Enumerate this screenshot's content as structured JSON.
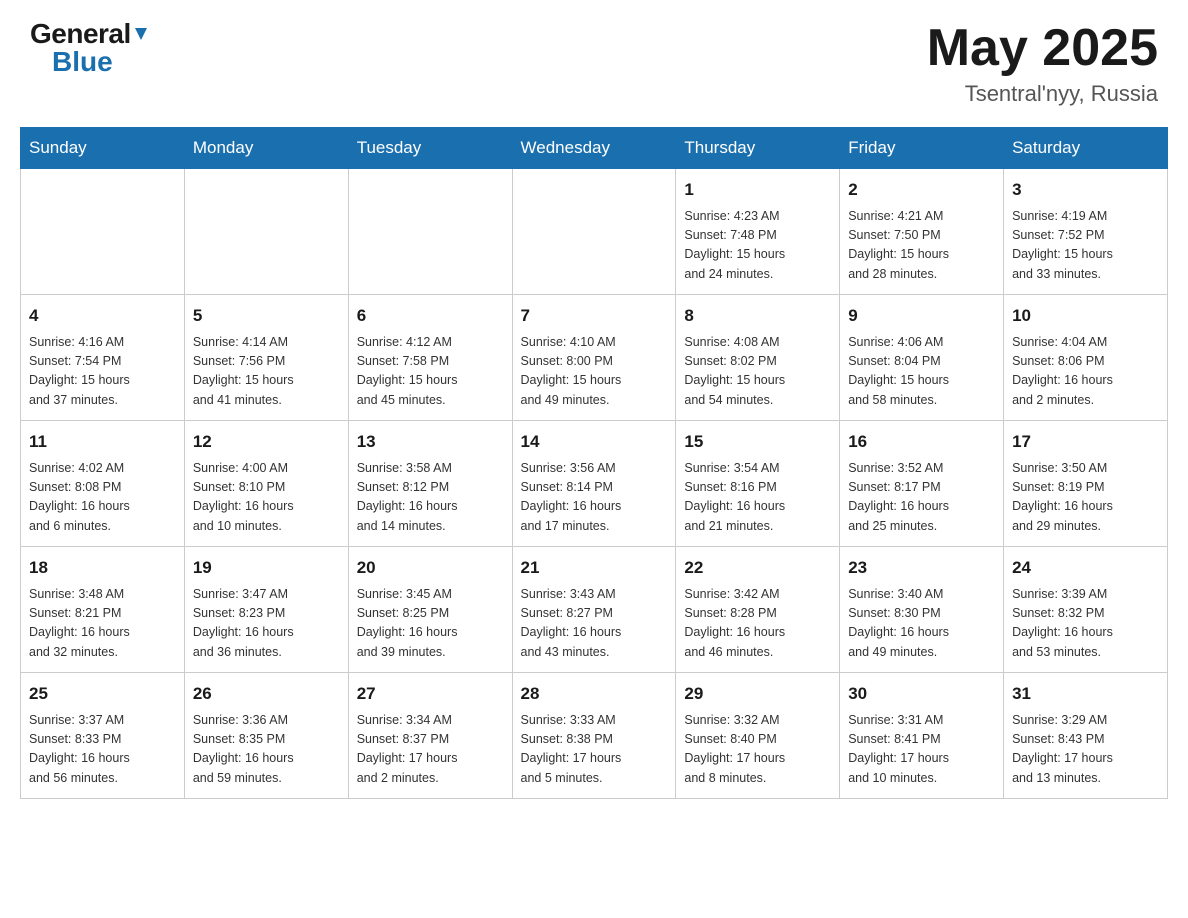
{
  "header": {
    "logo_general": "General",
    "logo_blue": "Blue",
    "title": "May 2025",
    "location": "Tsentral'nyy, Russia"
  },
  "days_of_week": [
    "Sunday",
    "Monday",
    "Tuesday",
    "Wednesday",
    "Thursday",
    "Friday",
    "Saturday"
  ],
  "weeks": [
    [
      {
        "day": "",
        "info": ""
      },
      {
        "day": "",
        "info": ""
      },
      {
        "day": "",
        "info": ""
      },
      {
        "day": "",
        "info": ""
      },
      {
        "day": "1",
        "info": "Sunrise: 4:23 AM\nSunset: 7:48 PM\nDaylight: 15 hours\nand 24 minutes."
      },
      {
        "day": "2",
        "info": "Sunrise: 4:21 AM\nSunset: 7:50 PM\nDaylight: 15 hours\nand 28 minutes."
      },
      {
        "day": "3",
        "info": "Sunrise: 4:19 AM\nSunset: 7:52 PM\nDaylight: 15 hours\nand 33 minutes."
      }
    ],
    [
      {
        "day": "4",
        "info": "Sunrise: 4:16 AM\nSunset: 7:54 PM\nDaylight: 15 hours\nand 37 minutes."
      },
      {
        "day": "5",
        "info": "Sunrise: 4:14 AM\nSunset: 7:56 PM\nDaylight: 15 hours\nand 41 minutes."
      },
      {
        "day": "6",
        "info": "Sunrise: 4:12 AM\nSunset: 7:58 PM\nDaylight: 15 hours\nand 45 minutes."
      },
      {
        "day": "7",
        "info": "Sunrise: 4:10 AM\nSunset: 8:00 PM\nDaylight: 15 hours\nand 49 minutes."
      },
      {
        "day": "8",
        "info": "Sunrise: 4:08 AM\nSunset: 8:02 PM\nDaylight: 15 hours\nand 54 minutes."
      },
      {
        "day": "9",
        "info": "Sunrise: 4:06 AM\nSunset: 8:04 PM\nDaylight: 15 hours\nand 58 minutes."
      },
      {
        "day": "10",
        "info": "Sunrise: 4:04 AM\nSunset: 8:06 PM\nDaylight: 16 hours\nand 2 minutes."
      }
    ],
    [
      {
        "day": "11",
        "info": "Sunrise: 4:02 AM\nSunset: 8:08 PM\nDaylight: 16 hours\nand 6 minutes."
      },
      {
        "day": "12",
        "info": "Sunrise: 4:00 AM\nSunset: 8:10 PM\nDaylight: 16 hours\nand 10 minutes."
      },
      {
        "day": "13",
        "info": "Sunrise: 3:58 AM\nSunset: 8:12 PM\nDaylight: 16 hours\nand 14 minutes."
      },
      {
        "day": "14",
        "info": "Sunrise: 3:56 AM\nSunset: 8:14 PM\nDaylight: 16 hours\nand 17 minutes."
      },
      {
        "day": "15",
        "info": "Sunrise: 3:54 AM\nSunset: 8:16 PM\nDaylight: 16 hours\nand 21 minutes."
      },
      {
        "day": "16",
        "info": "Sunrise: 3:52 AM\nSunset: 8:17 PM\nDaylight: 16 hours\nand 25 minutes."
      },
      {
        "day": "17",
        "info": "Sunrise: 3:50 AM\nSunset: 8:19 PM\nDaylight: 16 hours\nand 29 minutes."
      }
    ],
    [
      {
        "day": "18",
        "info": "Sunrise: 3:48 AM\nSunset: 8:21 PM\nDaylight: 16 hours\nand 32 minutes."
      },
      {
        "day": "19",
        "info": "Sunrise: 3:47 AM\nSunset: 8:23 PM\nDaylight: 16 hours\nand 36 minutes."
      },
      {
        "day": "20",
        "info": "Sunrise: 3:45 AM\nSunset: 8:25 PM\nDaylight: 16 hours\nand 39 minutes."
      },
      {
        "day": "21",
        "info": "Sunrise: 3:43 AM\nSunset: 8:27 PM\nDaylight: 16 hours\nand 43 minutes."
      },
      {
        "day": "22",
        "info": "Sunrise: 3:42 AM\nSunset: 8:28 PM\nDaylight: 16 hours\nand 46 minutes."
      },
      {
        "day": "23",
        "info": "Sunrise: 3:40 AM\nSunset: 8:30 PM\nDaylight: 16 hours\nand 49 minutes."
      },
      {
        "day": "24",
        "info": "Sunrise: 3:39 AM\nSunset: 8:32 PM\nDaylight: 16 hours\nand 53 minutes."
      }
    ],
    [
      {
        "day": "25",
        "info": "Sunrise: 3:37 AM\nSunset: 8:33 PM\nDaylight: 16 hours\nand 56 minutes."
      },
      {
        "day": "26",
        "info": "Sunrise: 3:36 AM\nSunset: 8:35 PM\nDaylight: 16 hours\nand 59 minutes."
      },
      {
        "day": "27",
        "info": "Sunrise: 3:34 AM\nSunset: 8:37 PM\nDaylight: 17 hours\nand 2 minutes."
      },
      {
        "day": "28",
        "info": "Sunrise: 3:33 AM\nSunset: 8:38 PM\nDaylight: 17 hours\nand 5 minutes."
      },
      {
        "day": "29",
        "info": "Sunrise: 3:32 AM\nSunset: 8:40 PM\nDaylight: 17 hours\nand 8 minutes."
      },
      {
        "day": "30",
        "info": "Sunrise: 3:31 AM\nSunset: 8:41 PM\nDaylight: 17 hours\nand 10 minutes."
      },
      {
        "day": "31",
        "info": "Sunrise: 3:29 AM\nSunset: 8:43 PM\nDaylight: 17 hours\nand 13 minutes."
      }
    ]
  ]
}
